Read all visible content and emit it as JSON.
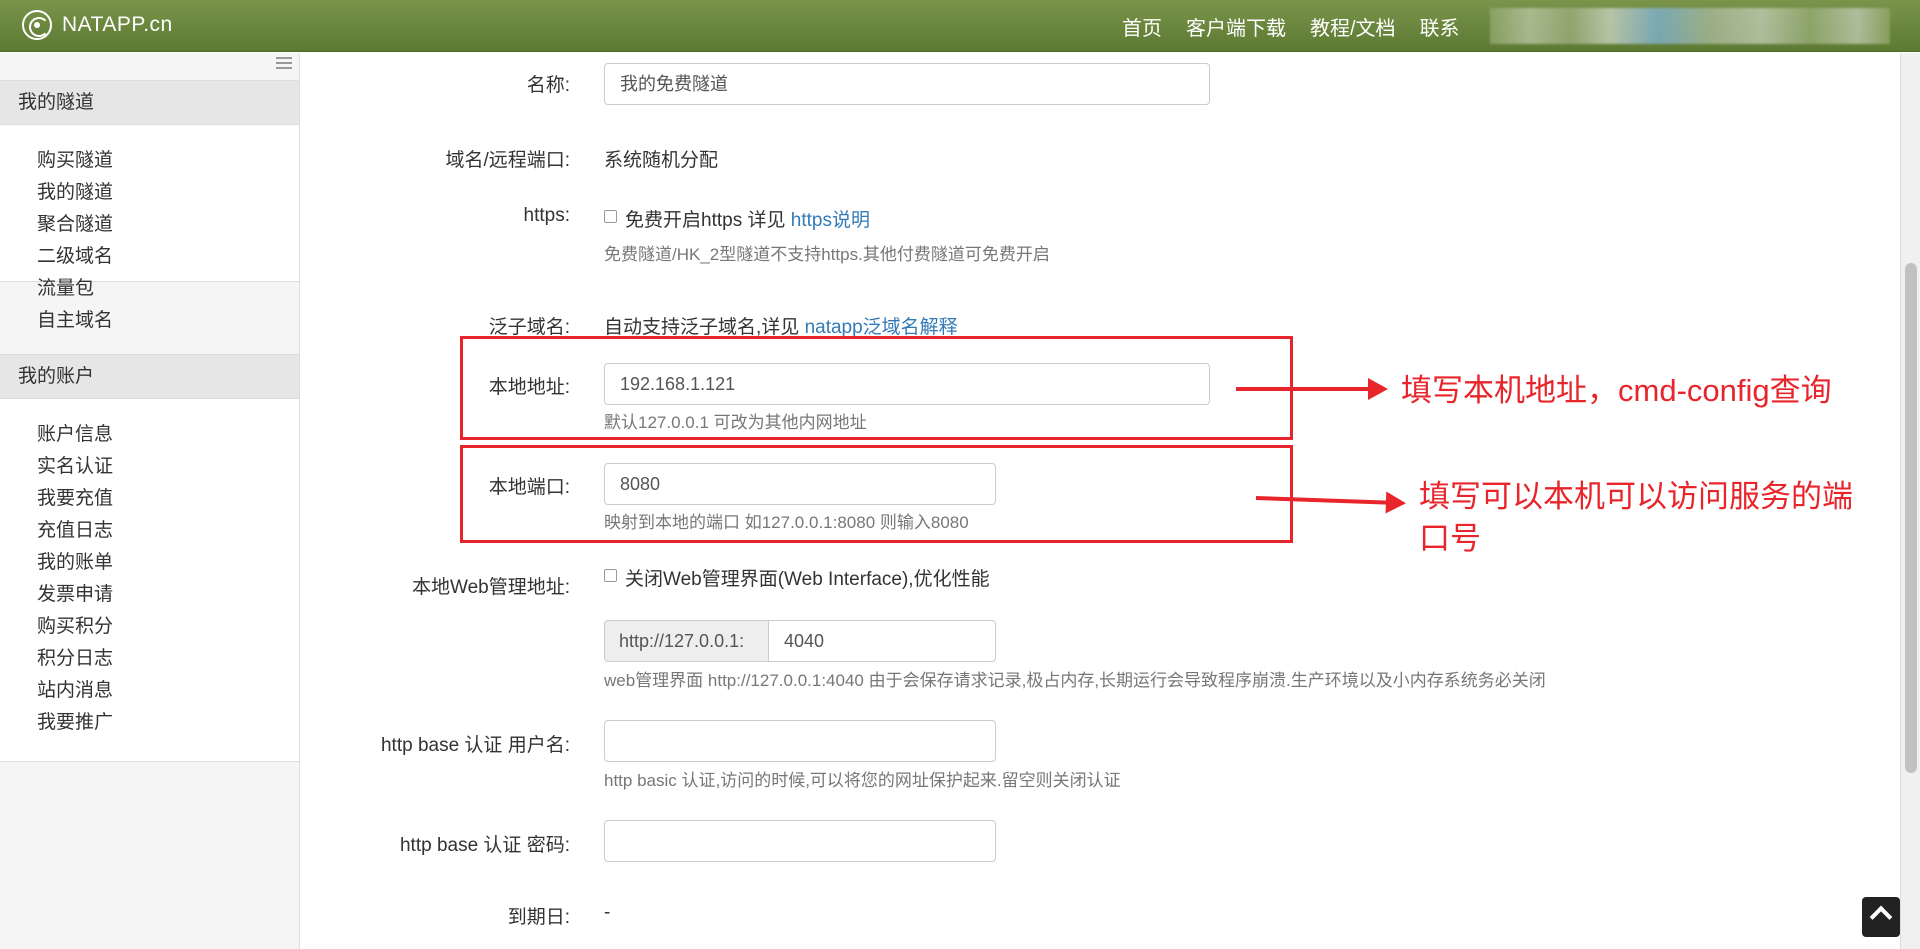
{
  "navbar": {
    "brand": "NATAPP.cn",
    "links": [
      "首页",
      "客户端下载",
      "教程/文档",
      "联系"
    ]
  },
  "sidebar": {
    "section1": {
      "title": "我的隧道",
      "items": [
        "购买隧道",
        "我的隧道",
        "聚合隧道",
        "二级域名",
        "流量包",
        "自主域名"
      ]
    },
    "section2": {
      "title": "我的账户",
      "items": [
        "账户信息",
        "实名认证",
        "我要充值",
        "充值日志",
        "我的账单",
        "发票申请",
        "购买积分",
        "积分日志",
        "站内消息",
        "我要推广"
      ]
    }
  },
  "form": {
    "name": {
      "label": "名称:",
      "value": "我的免费隧道"
    },
    "domain": {
      "label": "域名/远程端口:",
      "value": "系统随机分配"
    },
    "https": {
      "label": "https:",
      "checkbox_text": "免费开启https 详见 ",
      "link": "https说明",
      "help": "免费隧道/HK_2型隧道不支持https.其他付费隧道可免费开启"
    },
    "wildcard": {
      "label": "泛子域名:",
      "text": "自动支持泛子域名,详见 ",
      "link": "natapp泛域名解释"
    },
    "local_addr": {
      "label": "本地地址:",
      "value": "192.168.1.121",
      "help": "默认127.0.0.1 可改为其他内网地址"
    },
    "local_port": {
      "label": "本地端口:",
      "value": "8080",
      "help": "映射到本地的端口 如127.0.0.1:8080 则输入8080"
    },
    "web_admin": {
      "label": "本地Web管理地址:",
      "checkbox_text": "关闭Web管理界面(Web Interface),优化性能",
      "prefix": "http://127.0.0.1:",
      "port": "4040",
      "help": "web管理界面 http://127.0.0.1:4040 由于会保存请求记录,极占内存,长期运行会导致程序崩溃.生产环境以及小内存系统务必关闭"
    },
    "auth_user": {
      "label": "http base 认证 用户名:",
      "value": "",
      "help": "http basic 认证,访问的时候,可以将您的网址保护起来.留空则关闭认证"
    },
    "auth_pass": {
      "label": "http base 认证 密码:",
      "value": ""
    },
    "expire": {
      "label": "到期日:",
      "value": "-"
    }
  },
  "annotations": {
    "note1": "填写本机地址，cmd-config查询",
    "note2_line1": "填写可以本机可以访问服务的端",
    "note2_line2": "口号",
    "color": "#e8252b"
  }
}
